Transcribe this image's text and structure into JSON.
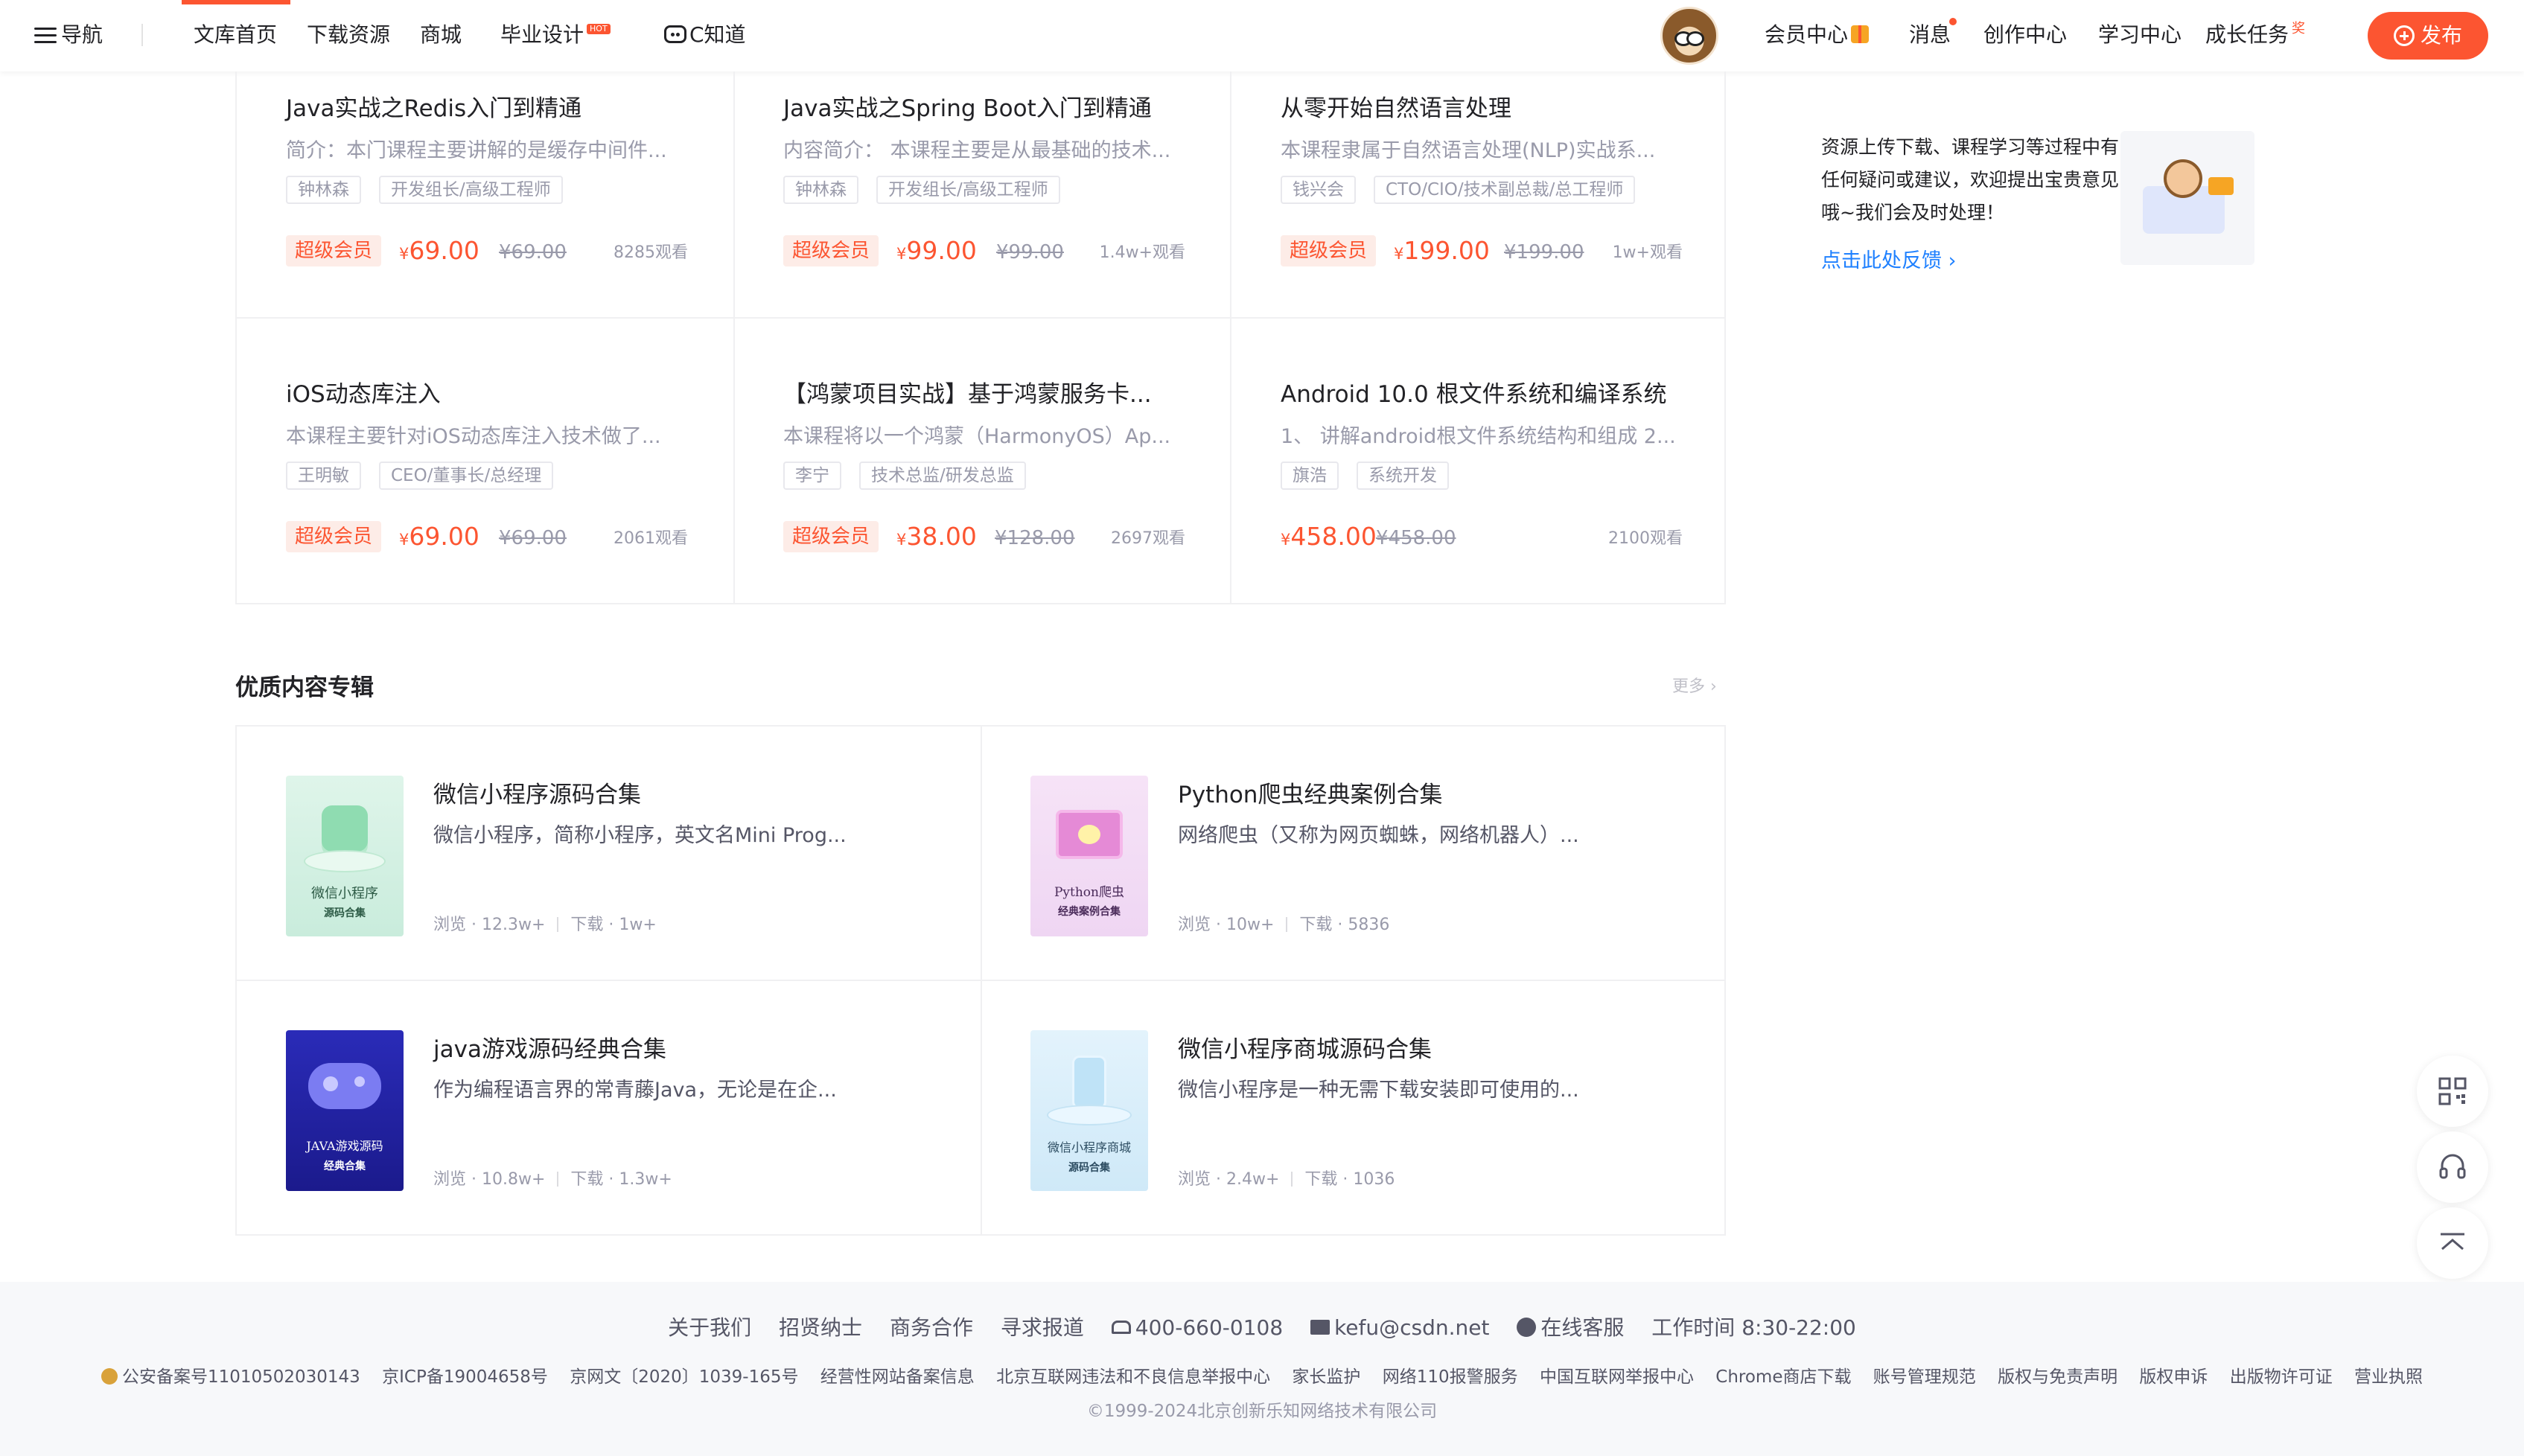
{
  "header": {
    "nav_label": "导航",
    "tabs": [
      "文库首页",
      "下载资源",
      "商城",
      "毕业设计",
      "C知道"
    ],
    "hot_badge": "HOT",
    "right_items": [
      "会员中心",
      "消息",
      "创作中心",
      "学习中心",
      "成长任务"
    ],
    "task_badge": "奖",
    "publish": "发布",
    "accent_color": "#fc5531"
  },
  "courses": [
    {
      "title": "Java实战之Redis入门到精通",
      "desc": "简介：本门课程主要讲解的是缓存中间件...",
      "author": "钟林森",
      "role": "开发组长/高级工程师",
      "vip": "超级会员",
      "price": "69.00",
      "old_price": "¥69.00",
      "views": "8285观看"
    },
    {
      "title": "Java实战之Spring Boot入门到精通",
      "desc": "内容简介： 本课程主要是从最基础的技术...",
      "author": "钟林森",
      "role": "开发组长/高级工程师",
      "vip": "超级会员",
      "price": "99.00",
      "old_price": "¥99.00",
      "views": "1.4w+观看"
    },
    {
      "title": "从零开始自然语言处理",
      "desc": "本课程隶属于自然语言处理(NLP)实战系...",
      "author": "钱兴会",
      "role": "CTO/CIO/技术副总裁/总工程师",
      "vip": "超级会员",
      "price": "199.00",
      "old_price": "¥199.00",
      "views": "1w+观看"
    },
    {
      "title": "iOS动态库注入",
      "desc": "本课程主要针对iOS动态库注入技术做了...",
      "author": "王明敏",
      "role": "CEO/董事长/总经理",
      "vip": "超级会员",
      "price": "69.00",
      "old_price": "¥69.00",
      "views": "2061观看"
    },
    {
      "title": "【鸿蒙项目实战】基于鸿蒙服务卡...",
      "desc": "本课程将以一个鸿蒙（HarmonyOS）Ap...",
      "author": "李宁",
      "role": "技术总监/研发总监",
      "vip": "超级会员",
      "price": "38.00",
      "old_price": "¥128.00",
      "views": "2697观看"
    },
    {
      "title": "Android 10.0 根文件系统和编译系统",
      "desc": "1、 讲解android根文件系统结构和组成 2...",
      "author": "旗浩",
      "role": "系统开发",
      "vip": "",
      "price": "458.00",
      "old_price": "¥458.00",
      "views": "2100观看"
    }
  ],
  "currency": "¥",
  "albums_section": {
    "title": "优质内容专辑",
    "more": "更多"
  },
  "albums": [
    {
      "title": "微信小程序源码合集",
      "desc": "微信小程序，简称小程序，英文名Mini Prog...",
      "browse": "浏览 · 12.3w+",
      "download": "下载 · 1w+",
      "cover_line1": "微信小程序",
      "cover_line2": "源码合集"
    },
    {
      "title": "Python爬虫经典案例合集",
      "desc": "网络爬虫（又称为网页蜘蛛，网络机器人）...",
      "browse": "浏览 · 10w+",
      "download": "下载 · 5836",
      "cover_line1": "Python爬虫",
      "cover_line2": "经典案例合集"
    },
    {
      "title": "java游戏源码经典合集",
      "desc": "作为编程语言界的常青藤Java，无论是在企...",
      "browse": "浏览 · 10.8w+",
      "download": "下载 · 1.3w+",
      "cover_line1": "JAVA游戏源码",
      "cover_line2": "经典合集"
    },
    {
      "title": "微信小程序商城源码合集",
      "desc": "微信小程序是一种无需下载安装即可使用的...",
      "browse": "浏览 · 2.4w+",
      "download": "下载 · 1036",
      "cover_line1": "微信小程序商城",
      "cover_line2": "源码合集"
    }
  ],
  "feedback": {
    "text": "资源上传下载、课程学习等过程中有任何疑问或建议，欢迎提出宝贵意见哦~我们会及时处理！",
    "link": "点击此处反馈"
  },
  "footer": {
    "row1": [
      "关于我们",
      "招贤纳士",
      "商务合作",
      "寻求报道",
      "400-660-0108",
      "kefu@csdn.net",
      "在线客服",
      "工作时间 8:30-22:00"
    ],
    "row2": [
      "公安备案号11010502030143",
      "京ICP备19004658号",
      "京网文〔2020〕1039-165号",
      "经营性网站备案信息",
      "北京互联网违法和不良信息举报中心",
      "家长监护",
      "网络110报警服务",
      "中国互联网举报中心",
      "Chrome商店下载",
      "账号管理规范",
      "版权与免责声明",
      "版权申诉",
      "出版物许可证",
      "营业执照"
    ],
    "copyright": "©1999-2024北京创新乐知网络技术有限公司"
  }
}
